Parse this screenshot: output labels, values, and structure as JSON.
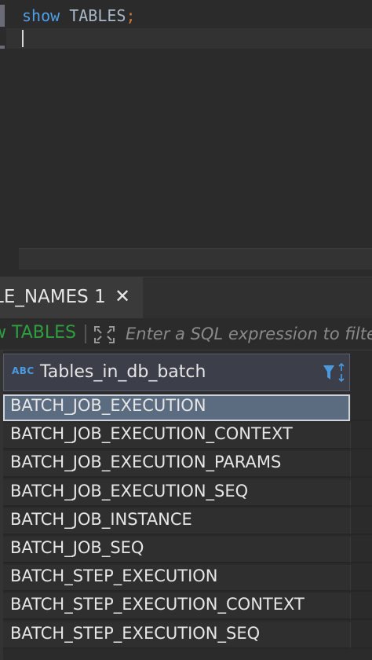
{
  "editor": {
    "keyword": "show",
    "identifier": "TABLES",
    "terminator": ";"
  },
  "results": {
    "tab_label": "LE_NAMES 1",
    "tab_close_glyph": "✕",
    "query_label": "w TABLES",
    "filter_placeholder": "Enter a SQL expression to filter",
    "column": {
      "type_icon": "ABC",
      "name": "Tables_in_db_batch"
    },
    "rows": [
      "BATCH_JOB_EXECUTION",
      "BATCH_JOB_EXECUTION_CONTEXT",
      "BATCH_JOB_EXECUTION_PARAMS",
      "BATCH_JOB_EXECUTION_SEQ",
      "BATCH_JOB_INSTANCE",
      "BATCH_JOB_SEQ",
      "BATCH_STEP_EXECUTION",
      "BATCH_STEP_EXECUTION_CONTEXT",
      "BATCH_STEP_EXECUTION_SEQ"
    ],
    "selected_row": 0
  },
  "colors": {
    "keyword": "#4f9fe6",
    "query_label": "#2e9e3f",
    "selection": "#5b6b80",
    "background": "#2b2b2b"
  },
  "icons": [
    "close-icon",
    "expand-icon",
    "abc-type-icon",
    "filter-icon",
    "sort-icon"
  ]
}
